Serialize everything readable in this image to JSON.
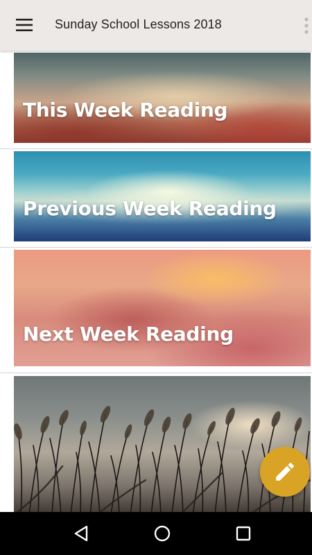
{
  "app_bar": {
    "title": "Sunday School Lessons 2018",
    "menu_icon": "hamburger-menu-icon",
    "overflow_icon": "more-vert-icon",
    "background_color": "#ece9e6"
  },
  "cards": [
    {
      "title": "This Week Reading"
    },
    {
      "title": "Previous Week Reading"
    },
    {
      "title": "Next Week Reading"
    },
    {
      "title": ""
    }
  ],
  "fab": {
    "icon": "pencil-icon",
    "color": "#d9a425"
  },
  "system_nav": {
    "back_icon": "back-triangle-icon",
    "home_icon": "home-circle-icon",
    "recents_icon": "recents-square-icon"
  }
}
